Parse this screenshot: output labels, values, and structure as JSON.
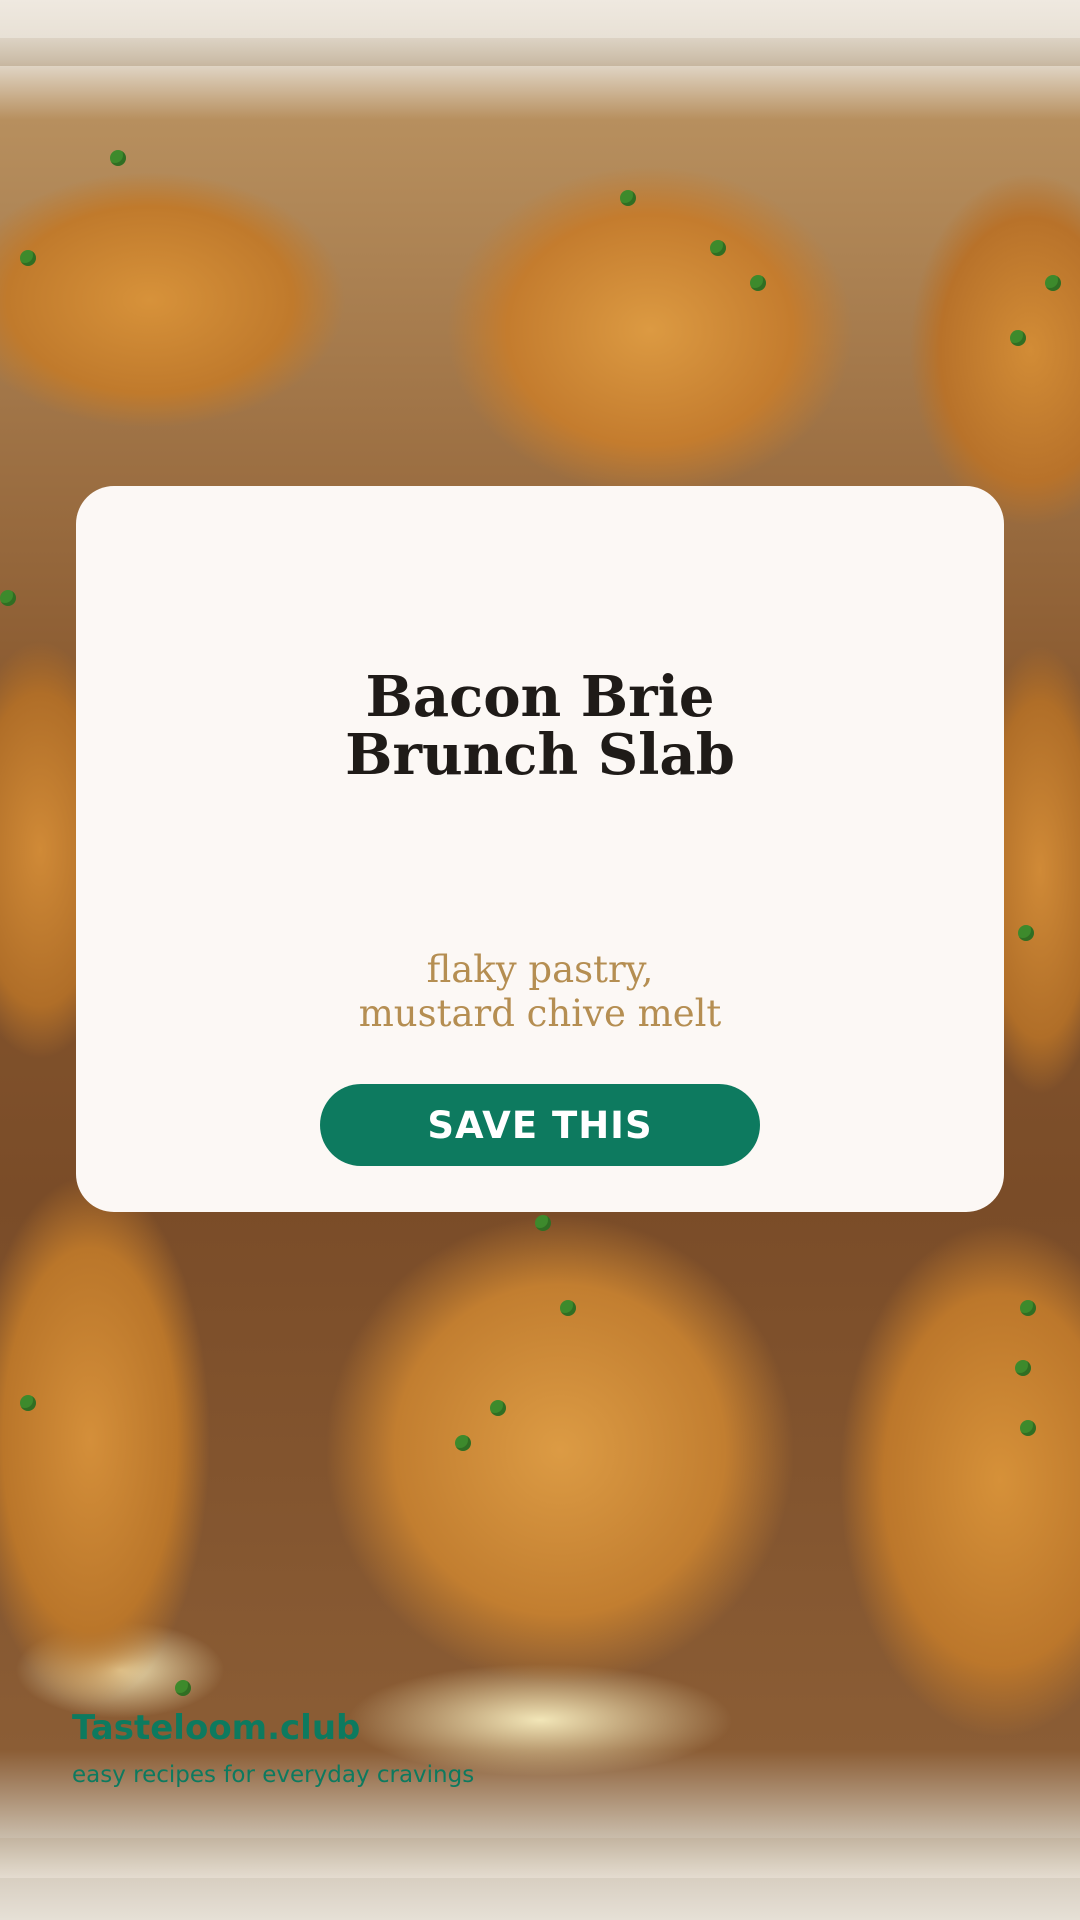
{
  "background": {
    "description_icon": "baked-pastry-photo"
  },
  "card": {
    "title_line_1": "Bacon Brie",
    "title_line_2": "Brunch Slab",
    "subtitle_line_1": "flaky pastry,",
    "subtitle_line_2": "mustard chive melt",
    "button_label": "SAVE THIS"
  },
  "brand": {
    "name": "Tasteloom.club",
    "tagline": "easy recipes for everyday cravings"
  },
  "colors": {
    "accent": "#0d7a5f",
    "card_background": "#fcf8f5",
    "title_text": "#1f1b18",
    "subtitle_text": "#b58e52"
  }
}
